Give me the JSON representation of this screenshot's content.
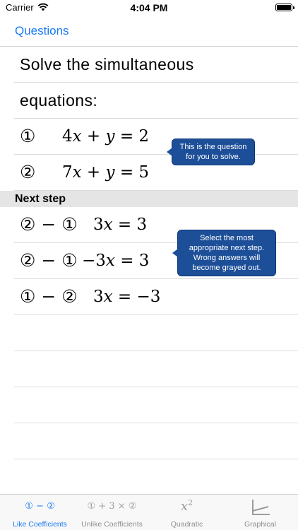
{
  "status_bar": {
    "carrier": "Carrier",
    "time": "4:04 PM"
  },
  "nav": {
    "back_label": "Questions"
  },
  "question": {
    "title_line1": "Solve the simultaneous",
    "title_line2": "equations:",
    "equations": [
      {
        "marker": "①",
        "coef": "4",
        "var1": "x",
        "op": " + ",
        "var2": "y",
        "rhs": " = 2"
      },
      {
        "marker": "②",
        "coef": "7",
        "var1": "x",
        "op": " + ",
        "var2": "y",
        "rhs": " = 5"
      }
    ]
  },
  "next_step": {
    "header": "Next step",
    "options": [
      {
        "ops": "② − ①",
        "lhs": "3",
        "var": "x",
        "rhs": " = 3"
      },
      {
        "ops": "② − ①",
        "lhs": "−3",
        "var": "x",
        "rhs": " = 3"
      },
      {
        "ops": "① − ②",
        "lhs": "3",
        "var": "x",
        "rhs": " = −3"
      }
    ]
  },
  "tooltips": {
    "question": "This is the question for you to solve.",
    "next_step": "Select the most appropriate next step. Wrong answers will become grayed out."
  },
  "tabs": [
    {
      "glyph": "① − ②",
      "label": "Like Coefficients",
      "active": true,
      "icon": "like-coefficients-icon"
    },
    {
      "glyph": "① + 3 × ②",
      "label": "Unlike Coefficients",
      "active": false,
      "icon": "unlike-coefficients-icon"
    },
    {
      "glyph_base": "x",
      "glyph_sup": "2",
      "label": "Quadratic",
      "active": false,
      "icon": "quadratic-icon"
    },
    {
      "label": "Graphical",
      "active": false,
      "icon": "graph-axes-icon"
    }
  ],
  "colors": {
    "accent": "#1b7af5",
    "tooltip": "#1d4f99",
    "section_header": "#e5e5e5",
    "inactive_tab": "#8e8e8e"
  }
}
